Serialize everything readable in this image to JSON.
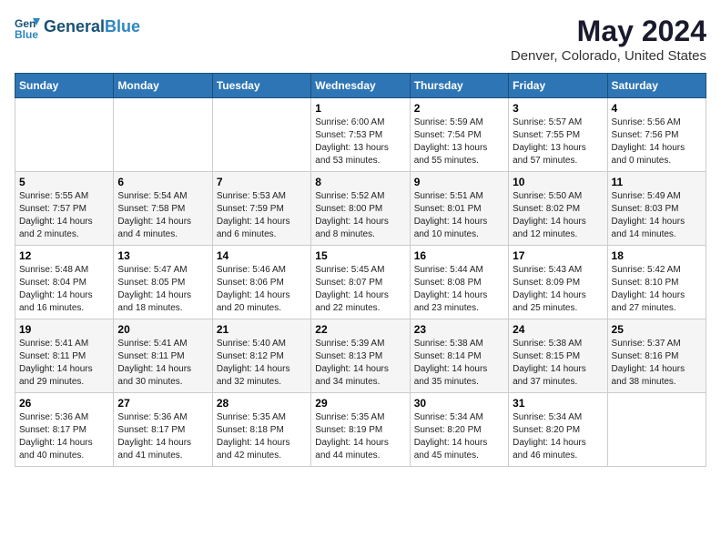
{
  "header": {
    "logo_line1": "General",
    "logo_line2": "Blue",
    "title": "May 2024",
    "subtitle": "Denver, Colorado, United States"
  },
  "weekdays": [
    "Sunday",
    "Monday",
    "Tuesday",
    "Wednesday",
    "Thursday",
    "Friday",
    "Saturday"
  ],
  "weeks": [
    [
      {
        "day": "",
        "info": ""
      },
      {
        "day": "",
        "info": ""
      },
      {
        "day": "",
        "info": ""
      },
      {
        "day": "1",
        "info": "Sunrise: 6:00 AM\nSunset: 7:53 PM\nDaylight: 13 hours\nand 53 minutes."
      },
      {
        "day": "2",
        "info": "Sunrise: 5:59 AM\nSunset: 7:54 PM\nDaylight: 13 hours\nand 55 minutes."
      },
      {
        "day": "3",
        "info": "Sunrise: 5:57 AM\nSunset: 7:55 PM\nDaylight: 13 hours\nand 57 minutes."
      },
      {
        "day": "4",
        "info": "Sunrise: 5:56 AM\nSunset: 7:56 PM\nDaylight: 14 hours\nand 0 minutes."
      }
    ],
    [
      {
        "day": "5",
        "info": "Sunrise: 5:55 AM\nSunset: 7:57 PM\nDaylight: 14 hours\nand 2 minutes."
      },
      {
        "day": "6",
        "info": "Sunrise: 5:54 AM\nSunset: 7:58 PM\nDaylight: 14 hours\nand 4 minutes."
      },
      {
        "day": "7",
        "info": "Sunrise: 5:53 AM\nSunset: 7:59 PM\nDaylight: 14 hours\nand 6 minutes."
      },
      {
        "day": "8",
        "info": "Sunrise: 5:52 AM\nSunset: 8:00 PM\nDaylight: 14 hours\nand 8 minutes."
      },
      {
        "day": "9",
        "info": "Sunrise: 5:51 AM\nSunset: 8:01 PM\nDaylight: 14 hours\nand 10 minutes."
      },
      {
        "day": "10",
        "info": "Sunrise: 5:50 AM\nSunset: 8:02 PM\nDaylight: 14 hours\nand 12 minutes."
      },
      {
        "day": "11",
        "info": "Sunrise: 5:49 AM\nSunset: 8:03 PM\nDaylight: 14 hours\nand 14 minutes."
      }
    ],
    [
      {
        "day": "12",
        "info": "Sunrise: 5:48 AM\nSunset: 8:04 PM\nDaylight: 14 hours\nand 16 minutes."
      },
      {
        "day": "13",
        "info": "Sunrise: 5:47 AM\nSunset: 8:05 PM\nDaylight: 14 hours\nand 18 minutes."
      },
      {
        "day": "14",
        "info": "Sunrise: 5:46 AM\nSunset: 8:06 PM\nDaylight: 14 hours\nand 20 minutes."
      },
      {
        "day": "15",
        "info": "Sunrise: 5:45 AM\nSunset: 8:07 PM\nDaylight: 14 hours\nand 22 minutes."
      },
      {
        "day": "16",
        "info": "Sunrise: 5:44 AM\nSunset: 8:08 PM\nDaylight: 14 hours\nand 23 minutes."
      },
      {
        "day": "17",
        "info": "Sunrise: 5:43 AM\nSunset: 8:09 PM\nDaylight: 14 hours\nand 25 minutes."
      },
      {
        "day": "18",
        "info": "Sunrise: 5:42 AM\nSunset: 8:10 PM\nDaylight: 14 hours\nand 27 minutes."
      }
    ],
    [
      {
        "day": "19",
        "info": "Sunrise: 5:41 AM\nSunset: 8:11 PM\nDaylight: 14 hours\nand 29 minutes."
      },
      {
        "day": "20",
        "info": "Sunrise: 5:41 AM\nSunset: 8:11 PM\nDaylight: 14 hours\nand 30 minutes."
      },
      {
        "day": "21",
        "info": "Sunrise: 5:40 AM\nSunset: 8:12 PM\nDaylight: 14 hours\nand 32 minutes."
      },
      {
        "day": "22",
        "info": "Sunrise: 5:39 AM\nSunset: 8:13 PM\nDaylight: 14 hours\nand 34 minutes."
      },
      {
        "day": "23",
        "info": "Sunrise: 5:38 AM\nSunset: 8:14 PM\nDaylight: 14 hours\nand 35 minutes."
      },
      {
        "day": "24",
        "info": "Sunrise: 5:38 AM\nSunset: 8:15 PM\nDaylight: 14 hours\nand 37 minutes."
      },
      {
        "day": "25",
        "info": "Sunrise: 5:37 AM\nSunset: 8:16 PM\nDaylight: 14 hours\nand 38 minutes."
      }
    ],
    [
      {
        "day": "26",
        "info": "Sunrise: 5:36 AM\nSunset: 8:17 PM\nDaylight: 14 hours\nand 40 minutes."
      },
      {
        "day": "27",
        "info": "Sunrise: 5:36 AM\nSunset: 8:17 PM\nDaylight: 14 hours\nand 41 minutes."
      },
      {
        "day": "28",
        "info": "Sunrise: 5:35 AM\nSunset: 8:18 PM\nDaylight: 14 hours\nand 42 minutes."
      },
      {
        "day": "29",
        "info": "Sunrise: 5:35 AM\nSunset: 8:19 PM\nDaylight: 14 hours\nand 44 minutes."
      },
      {
        "day": "30",
        "info": "Sunrise: 5:34 AM\nSunset: 8:20 PM\nDaylight: 14 hours\nand 45 minutes."
      },
      {
        "day": "31",
        "info": "Sunrise: 5:34 AM\nSunset: 8:20 PM\nDaylight: 14 hours\nand 46 minutes."
      },
      {
        "day": "",
        "info": ""
      }
    ]
  ]
}
